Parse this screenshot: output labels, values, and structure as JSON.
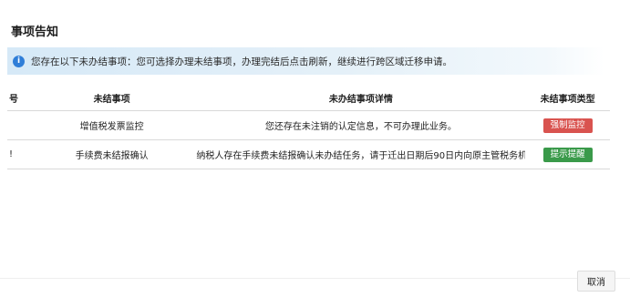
{
  "dialog": {
    "title": "事项告知",
    "notice": "您存在以下未办结事项：您可选择办理未结事项，办理完结后点击刷新，继续进行跨区域迁移申请。",
    "cancel_label": "取消"
  },
  "table": {
    "headers": {
      "no": "号",
      "item": "未结事项",
      "detail": "未办结事项详情",
      "type": "未结事项类型"
    },
    "rows": [
      {
        "no": "",
        "item": "增值税发票监控",
        "detail": "您还存在未注销的认定信息，不可办理此业务。",
        "type": "强制监控",
        "type_color": "#d9534f"
      },
      {
        "no": "!",
        "item": "手续费未结报确认",
        "detail": "纳税人存在手续费未结报确认未办结任务，请于迁出日期后90日内向原主管税务机...",
        "type": "提示提醒",
        "type_color": "#3a9a4a"
      }
    ]
  },
  "colors": {
    "notice_bg": "#d6e9f7",
    "info_icon": "#2f7ed8",
    "tag_red": "#d9534f",
    "tag_green": "#3a9a4a"
  }
}
